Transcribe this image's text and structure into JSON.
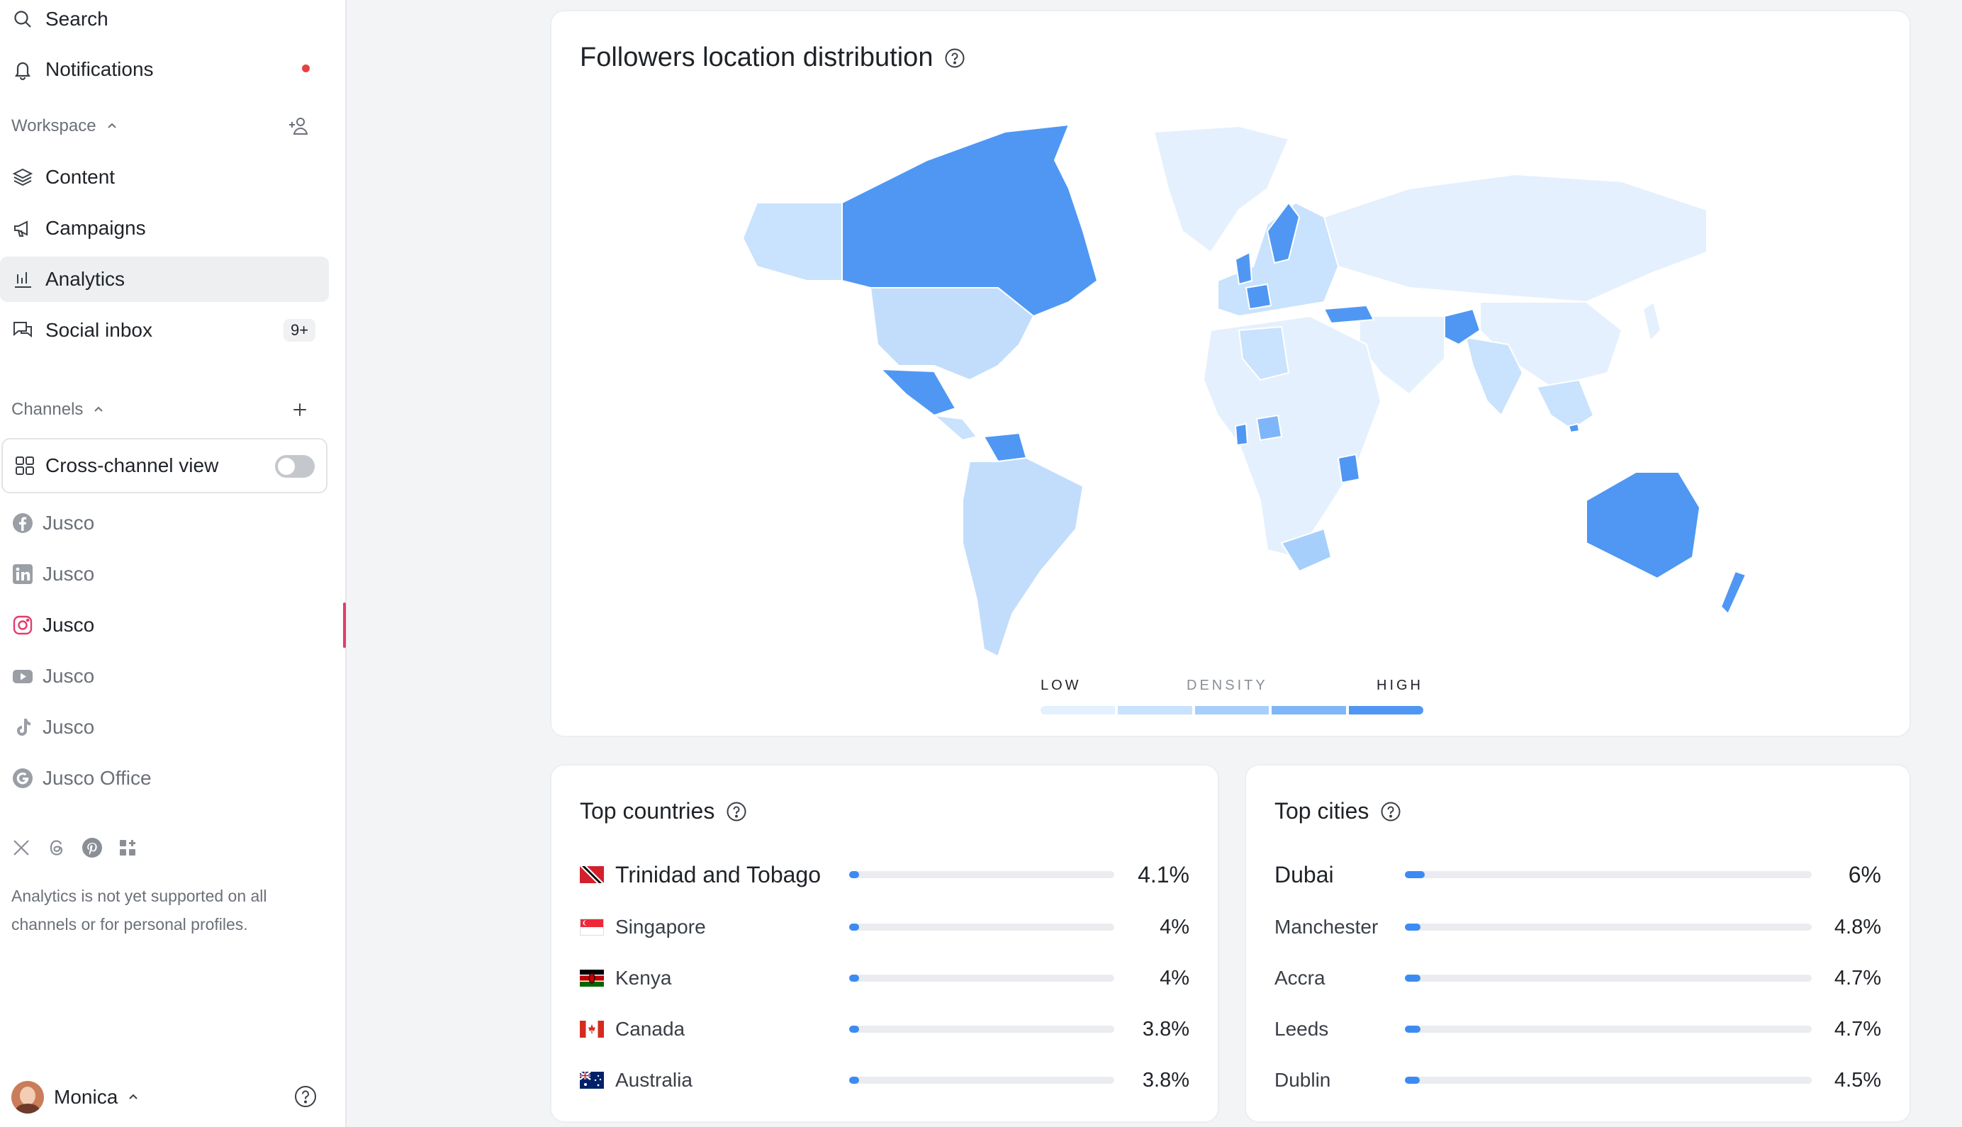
{
  "sidebar": {
    "search": "Search",
    "notifications": "Notifications",
    "workspace_label": "Workspace",
    "nav": {
      "content": "Content",
      "campaigns": "Campaigns",
      "analytics": "Analytics",
      "social_inbox": "Social inbox",
      "social_inbox_badge": "9+"
    },
    "channels_label": "Channels",
    "cross_channel": "Cross-channel view",
    "channels": [
      {
        "network": "facebook",
        "name": "Jusco"
      },
      {
        "network": "linkedin",
        "name": "Jusco"
      },
      {
        "network": "instagram",
        "name": "Jusco"
      },
      {
        "network": "youtube",
        "name": "Jusco"
      },
      {
        "network": "tiktok",
        "name": "Jusco"
      },
      {
        "network": "google",
        "name": "Jusco Office"
      }
    ],
    "unsupported_icons": [
      "x-icon",
      "threads-icon",
      "pinterest-icon",
      "more-apps-icon"
    ],
    "note": "Analytics is not yet supported on all channels or for personal profiles.",
    "user": "Monica"
  },
  "map_card": {
    "title": "Followers location distribution",
    "legend": {
      "low": "LOW",
      "mid": "DENSITY",
      "high": "HIGH"
    },
    "legend_colors": [
      "#e3f0fd",
      "#c9e2fd",
      "#a7cffb",
      "#7eb6f9",
      "#4f97f3"
    ]
  },
  "countries_card": {
    "title": "Top countries",
    "rows": [
      {
        "name": "Trinidad and Tobago",
        "value": "4.1%",
        "pct": 4.1
      },
      {
        "name": "Singapore",
        "value": "4%",
        "pct": 4.0
      },
      {
        "name": "Kenya",
        "value": "4%",
        "pct": 4.0
      },
      {
        "name": "Canada",
        "value": "3.8%",
        "pct": 3.8
      },
      {
        "name": "Australia",
        "value": "3.8%",
        "pct": 3.8
      }
    ]
  },
  "cities_card": {
    "title": "Top cities",
    "rows": [
      {
        "name": "Dubai",
        "value": "6%",
        "pct": 6.0
      },
      {
        "name": "Manchester",
        "value": "4.8%",
        "pct": 4.8
      },
      {
        "name": "Accra",
        "value": "4.7%",
        "pct": 4.7
      },
      {
        "name": "Leeds",
        "value": "4.7%",
        "pct": 4.7
      },
      {
        "name": "Dublin",
        "value": "4.5%",
        "pct": 4.5
      }
    ]
  },
  "colors": {
    "accent": "#3d8bf2",
    "map_high": "#4f97f3",
    "map_mid": "#c2ddfc",
    "map_low": "#e4f0fd",
    "notification_dot": "#e8413e",
    "instagram_accent": "#e33b6d"
  }
}
